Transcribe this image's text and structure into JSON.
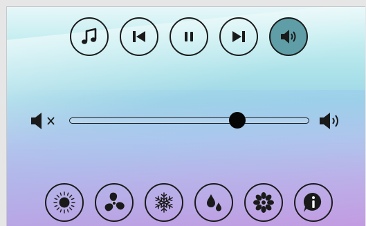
{
  "colors": {
    "stroke": "#1a1a1a",
    "active_button_fill": "#5f9ea7",
    "thumb": "#050505"
  },
  "media_controls": [
    {
      "name": "music-icon",
      "active": false
    },
    {
      "name": "previous-track-icon",
      "active": false
    },
    {
      "name": "pause-icon",
      "active": false
    },
    {
      "name": "next-track-icon",
      "active": false
    },
    {
      "name": "volume-icon",
      "active": true
    }
  ],
  "volume_slider": {
    "min_icon": "mute-icon",
    "max_icon": "volume-up-icon",
    "value_percent": 70
  },
  "mode_controls": [
    {
      "name": "sun-icon"
    },
    {
      "name": "fan-icon"
    },
    {
      "name": "snowflake-icon"
    },
    {
      "name": "droplets-icon"
    },
    {
      "name": "flower-icon"
    },
    {
      "name": "info-icon"
    }
  ]
}
